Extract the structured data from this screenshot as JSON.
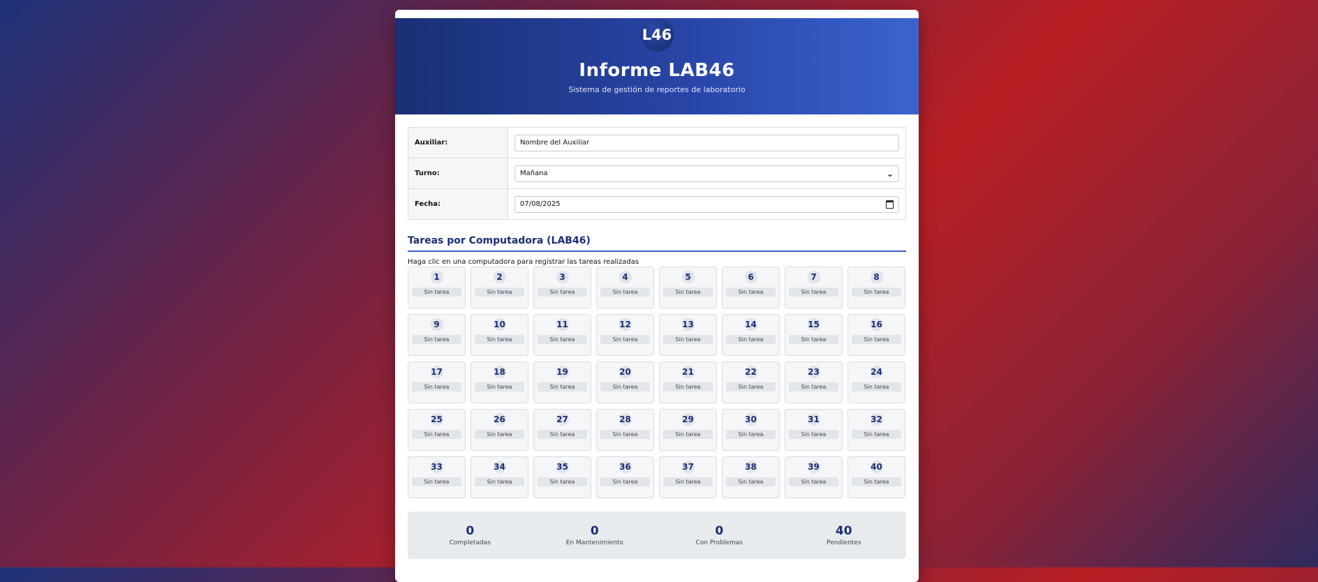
{
  "header": {
    "logo_text": "L46",
    "title": "Informe LAB46",
    "subtitle": "Sistema de gestión de reportes de laboratorio"
  },
  "form": {
    "auxiliar_label": "Auxiliar:",
    "auxiliar_value": "Nombre del Auxiliar",
    "turno_label": "Turno:",
    "turno_value": "Mañana",
    "fecha_label": "Fecha:",
    "fecha_value": "07/08/2025"
  },
  "tasks": {
    "title": "Tareas por Computadora (LAB46)",
    "hint": "Haga clic en una computadora para registrar las tareas realizadas",
    "status_label": "Sin tarea",
    "computers": [
      1,
      2,
      3,
      4,
      5,
      6,
      7,
      8,
      9,
      10,
      11,
      12,
      13,
      14,
      15,
      16,
      17,
      18,
      19,
      20,
      21,
      22,
      23,
      24,
      25,
      26,
      27,
      28,
      29,
      30,
      31,
      32,
      33,
      34,
      35,
      36,
      37,
      38,
      39,
      40
    ]
  },
  "stats": {
    "completadas_value": "0",
    "completadas_label": "Completadas",
    "mantenimiento_value": "0",
    "mantenimiento_label": "En Mantenimiento",
    "problemas_value": "0",
    "problemas_label": "Con Problemas",
    "pendientes_value": "40",
    "pendientes_label": "Pendientes"
  },
  "colors": {
    "accent": "#1a2f74",
    "header_end": "#3b63cf"
  }
}
